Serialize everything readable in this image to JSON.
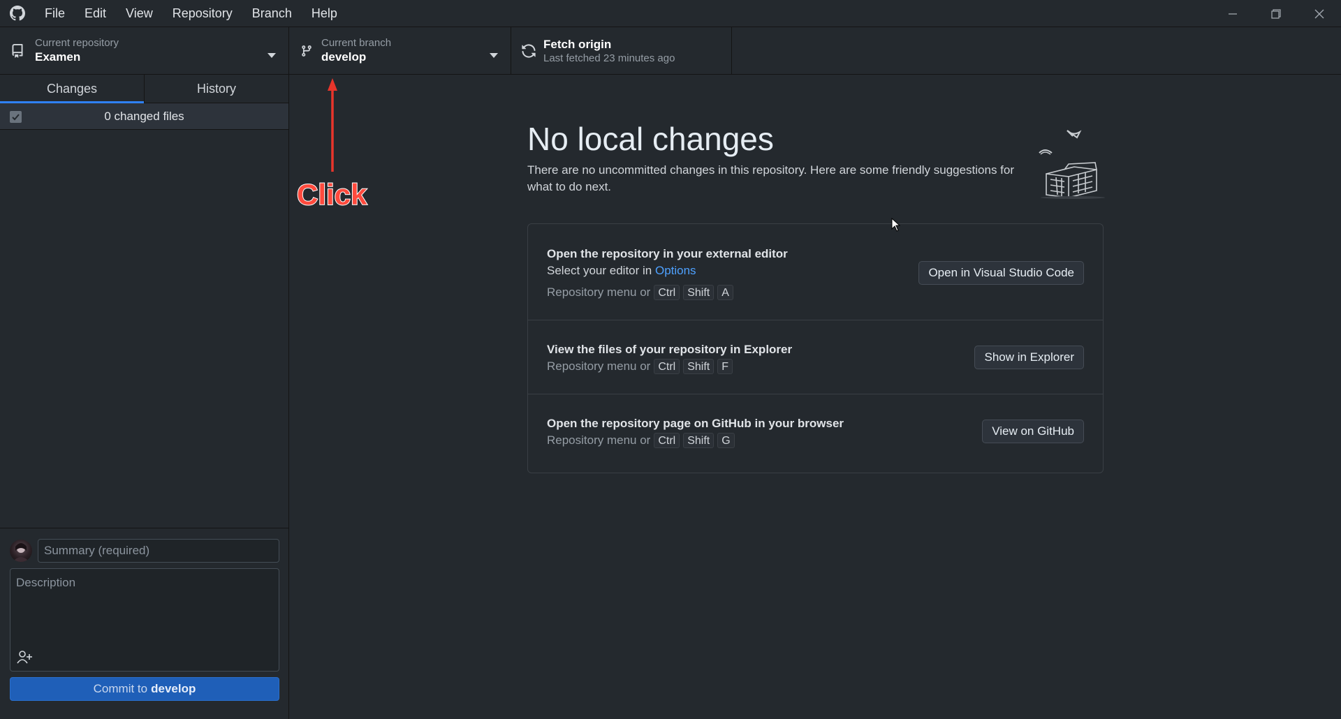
{
  "menu": {
    "items": [
      "File",
      "Edit",
      "View",
      "Repository",
      "Branch",
      "Help"
    ]
  },
  "toolbar": {
    "repository_label": "Current repository",
    "repository_value": "Examen",
    "branch_label": "Current branch",
    "branch_value": "develop",
    "fetch_label": "Fetch origin",
    "fetch_status": "Last fetched 23 minutes ago"
  },
  "sidebar": {
    "tabs": [
      "Changes",
      "History"
    ],
    "active_tab": "Changes",
    "changed_files": "0 changed files",
    "summary_placeholder": "Summary (required)",
    "description_placeholder": "Description",
    "commit_prefix": "Commit to",
    "commit_branch": "develop"
  },
  "main": {
    "title": "No local changes",
    "description": "There are no uncommitted changes in this repository. Here are some friendly suggestions for what to do next.",
    "actions": [
      {
        "title": "Open the repository in your external editor",
        "subtitle_prefix": "Select your editor in ",
        "subtitle_link": "Options",
        "shortcut_prefix": "Repository menu or",
        "keys": [
          "Ctrl",
          "Shift",
          "A"
        ],
        "button": "Open in Visual Studio Code"
      },
      {
        "title": "View the files of your repository in Explorer",
        "shortcut_prefix": "Repository menu or",
        "keys": [
          "Ctrl",
          "Shift",
          "F"
        ],
        "button": "Show in Explorer"
      },
      {
        "title": "Open the repository page on GitHub in your browser",
        "shortcut_prefix": "Repository menu or",
        "keys": [
          "Ctrl",
          "Shift",
          "G"
        ],
        "button": "View on GitHub"
      }
    ]
  },
  "annotation": {
    "text": "Click",
    "color": "#ff4a3d"
  },
  "colors": {
    "background": "#24292e",
    "accent": "#2f81f7",
    "commit_button": "#1f5fb8",
    "link": "#4ea1ff"
  }
}
